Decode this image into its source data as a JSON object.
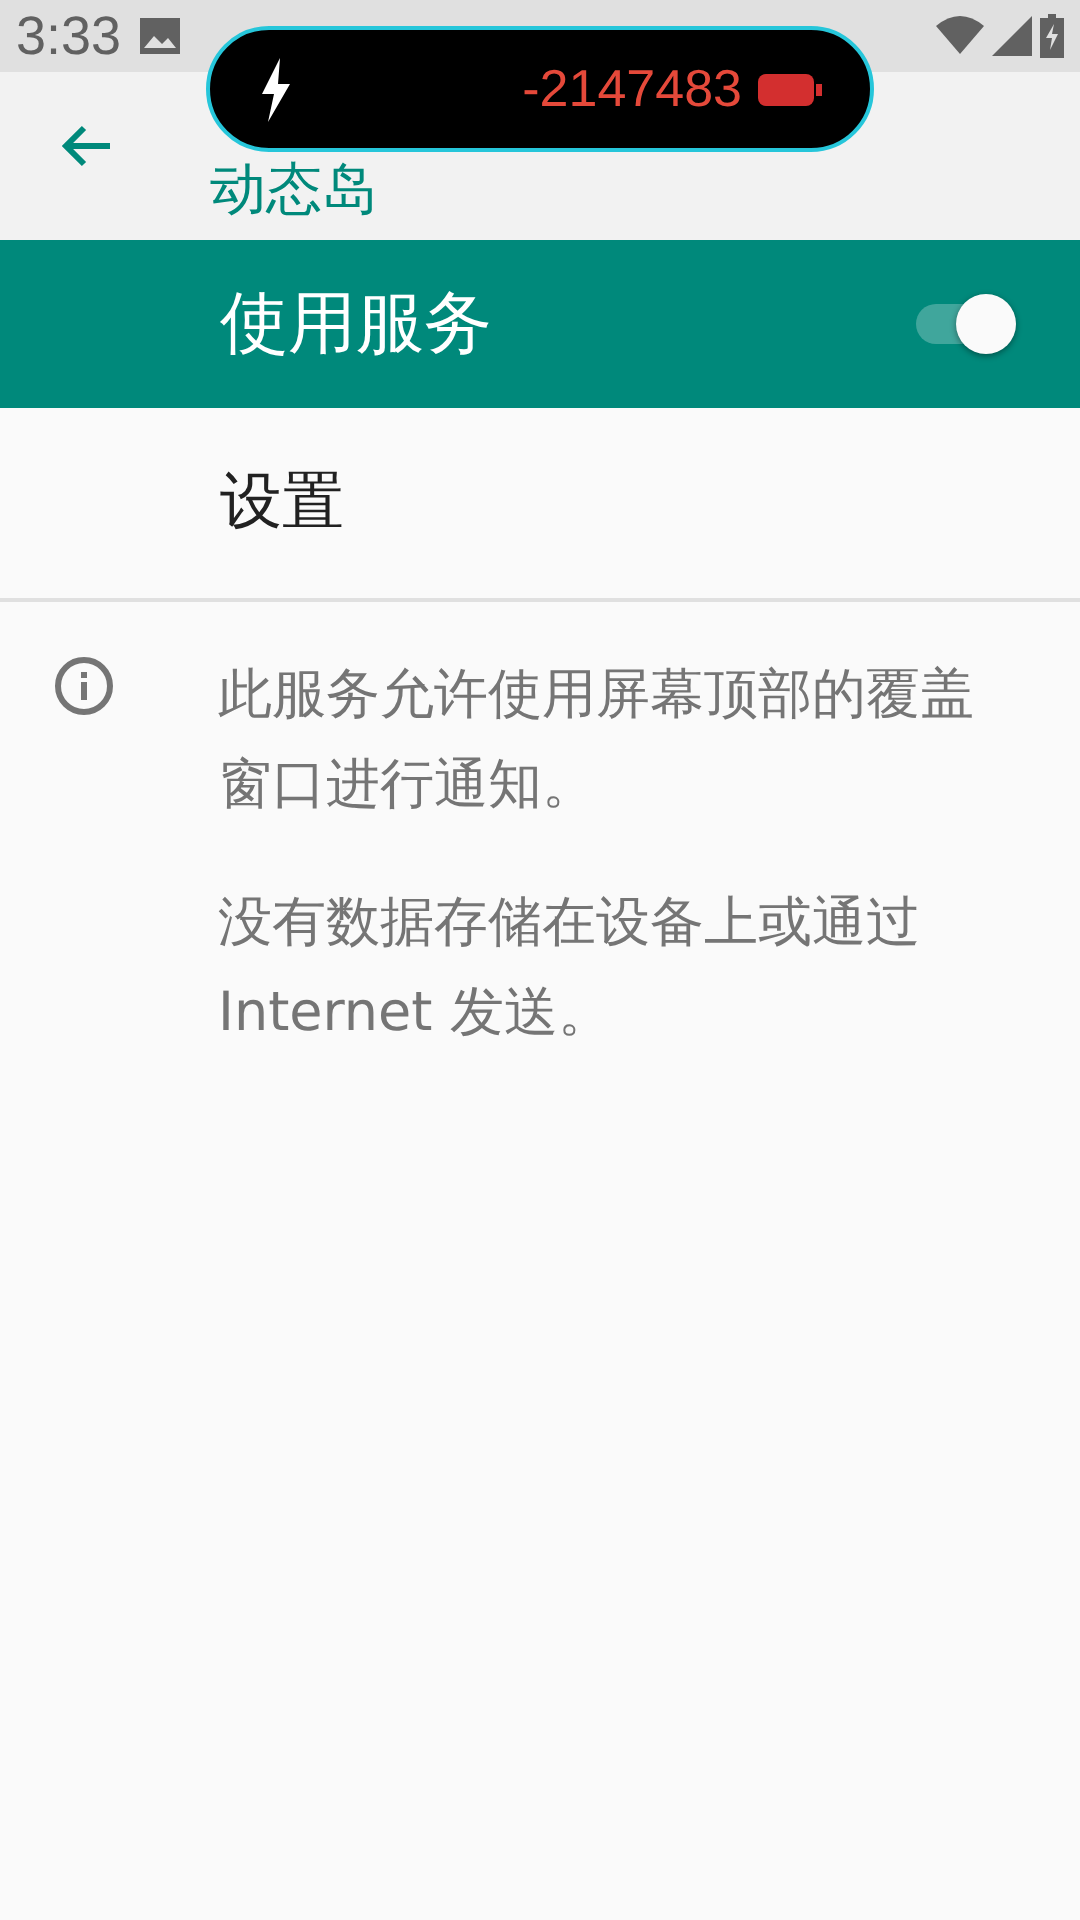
{
  "status_bar": {
    "time": "3:33"
  },
  "overlay": {
    "reading": "-2147483"
  },
  "app_bar": {
    "title": "动态岛"
  },
  "master_switch": {
    "label": "使用服务",
    "on": true
  },
  "items": [
    {
      "label": "设置"
    }
  ],
  "info": {
    "paragraphs": [
      "此服务允许使用屏幕顶部的覆盖窗口进行通知。",
      "没有数据存储在设备上或通过 Internet 发送。"
    ]
  }
}
